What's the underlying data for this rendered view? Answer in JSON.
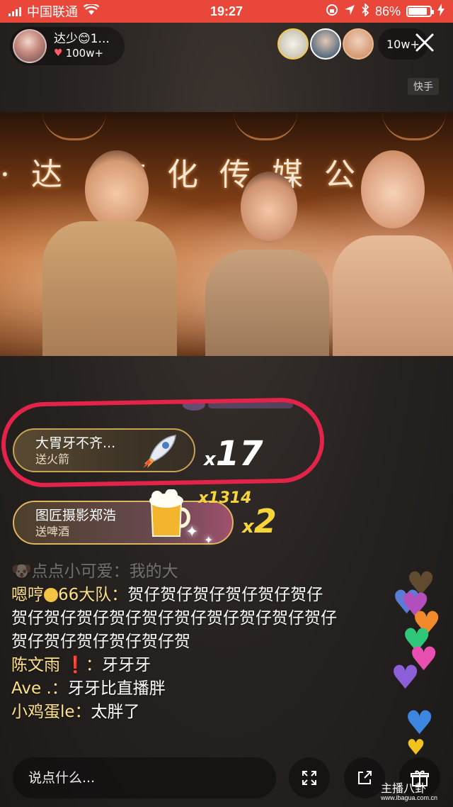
{
  "status_bar": {
    "carrier": "中国联通",
    "time": "19:27",
    "battery_percent": "86%",
    "battery_level": 0.86
  },
  "host": {
    "name": "达少😊1...",
    "likes": "100w+"
  },
  "viewers": {
    "count": "10w+"
  },
  "platform_tag": "快手",
  "video": {
    "banner_text": "·达  文化传媒公"
  },
  "gifts": [
    {
      "sender": "大胃牙不齐...",
      "action": "送火箭",
      "combo": "17",
      "icon": "rocket-icon"
    },
    {
      "sender": "图匠摄影郑浩",
      "action": "送啤酒",
      "combo": "2",
      "combo_total": "x1314",
      "icon": "beer-icon"
    }
  ],
  "chat": [
    {
      "user": "点点小可爱",
      "sep": "：",
      "text": "我的大"
    },
    {
      "user": "嗯哼",
      "mid": "66大队",
      "sep": "：",
      "text": "贺仔贺仔贺仔贺仔贺仔贺仔贺仔贺仔贺仔贺仔贺仔贺仔贺仔贺仔贺仔贺仔贺仔贺仔贺仔贺仔贺仔贺"
    },
    {
      "user": "陈文雨",
      "mark": "❗",
      "sep": "：",
      "text": "牙牙牙"
    },
    {
      "user": "Ave .",
      "sep": "：",
      "text": "牙牙比直播胖"
    },
    {
      "user": "小鸡蛋le",
      "sep": "：",
      "text": "太胖了"
    }
  ],
  "input": {
    "placeholder": "说点什么..."
  },
  "watermark": {
    "title": "主播八卦",
    "url": "www.ibagua.com.cn"
  },
  "colors": {
    "status_bar": "#e8473a",
    "annotation_circle": "#e3234a",
    "gift_border": "#c8a257",
    "combo_yellow": "#f7d43a"
  }
}
